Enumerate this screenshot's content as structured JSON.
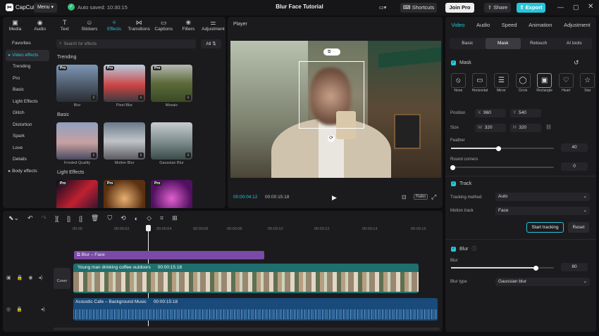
{
  "app": {
    "name": "CapCut",
    "menu": "Menu",
    "autosave": "Auto saved: 10:30:15",
    "title": "Blur Face Tutorial",
    "shortcuts": "Shortcuts",
    "join_pro": "Join Pro",
    "share": "Share",
    "export": "Export"
  },
  "toolbar_tabs": [
    {
      "label": "Media",
      "icon": "media-icon"
    },
    {
      "label": "Audio",
      "icon": "audio-icon"
    },
    {
      "label": "Text",
      "icon": "text-icon"
    },
    {
      "label": "Stickers",
      "icon": "stickers-icon"
    },
    {
      "label": "Effects",
      "icon": "effects-icon"
    },
    {
      "label": "Transitions",
      "icon": "transitions-icon"
    },
    {
      "label": "Captions",
      "icon": "captions-icon"
    },
    {
      "label": "Filters",
      "icon": "filters-icon"
    },
    {
      "label": "Adjustment",
      "icon": "adjustment-icon"
    }
  ],
  "sidebar": [
    "Favorites",
    "Video effects",
    "Trending",
    "Pro",
    "Basic",
    "Light Effects",
    "Glitch",
    "Distortion",
    "Spark",
    "Love",
    "Details",
    "Body effects"
  ],
  "effects": {
    "search_placeholder": "Search for effects",
    "filter": "All",
    "sections": [
      {
        "title": "Trending",
        "items": [
          {
            "name": "Blur",
            "pro": true
          },
          {
            "name": "Pixel Blur",
            "pro": true
          },
          {
            "name": "Mosaic",
            "pro": true
          }
        ]
      },
      {
        "title": "Basic",
        "items": [
          {
            "name": "Frosted Quality",
            "pro": false
          },
          {
            "name": "Motion Blur",
            "pro": false
          },
          {
            "name": "Gaussian Blur",
            "pro": false
          }
        ]
      },
      {
        "title": "Light Effects",
        "items": [
          {
            "name": "",
            "pro": true
          },
          {
            "name": "",
            "pro": true
          },
          {
            "name": "",
            "pro": true
          }
        ]
      }
    ],
    "pro_badge": "Pro"
  },
  "player": {
    "label": "Player",
    "current": "00:00:04:12",
    "duration": "00:00:15:18",
    "ratio": "Ratio"
  },
  "right": {
    "tabs": [
      "Video",
      "Audio",
      "Speed",
      "Animation",
      "Adjustment"
    ],
    "subtabs": [
      "Basic",
      "Mask",
      "Retouch",
      "AI tools"
    ],
    "mask_label": "Mask",
    "shapes": [
      "None",
      "Horizontal",
      "Mirror",
      "Circle",
      "Rectangle",
      "Heart",
      "Star"
    ],
    "position_label": "Position",
    "pos_x": "960",
    "pos_y": "540",
    "size_label": "Size",
    "size_w": "320",
    "size_h": "320",
    "feather_label": "Feather",
    "feather_value": "40",
    "feather_fraction": 0.4,
    "round_label": "Round corners",
    "round_value": "0",
    "round_fraction": 0,
    "track_label": "Track",
    "tracking_method_label": "Tracking method",
    "tracking_method": "Auto",
    "motion_track_label": "Motion track",
    "motion_track": "Face",
    "start_tracking": "Start tracking",
    "reset": "Reset",
    "blur_label": "Blur",
    "blur_amount_label": "Blur",
    "blur_value": "80",
    "blur_fraction": 0.8,
    "blur_type_label": "Blur type",
    "blur_type": "Gaussian blur"
  },
  "timeline": {
    "ruler": [
      "00:00",
      "00:00:02",
      "00:00:04",
      "00:00:06",
      "00:00:08",
      "00:00:10",
      "00:00:12",
      "00:00:14",
      "00:00:16"
    ],
    "effect_clip": "Blur – Face",
    "video_clip": "Young man drinking coffee outdoors",
    "video_duration": "00:00:15:18",
    "audio_clip": "Acoustic Cafe – Background Music",
    "audio_duration": "00:00:15:18",
    "cover": "Cover",
    "letters": {
      "x": "X",
      "y": "Y",
      "w": "W",
      "h": "H"
    }
  },
  "colors": {
    "accent": "#26c6da",
    "effect_clip": "#7b4aa6",
    "video_clip": "#1f6f6f",
    "audio_clip": "#1a4a7a",
    "export": "#26c6da"
  }
}
